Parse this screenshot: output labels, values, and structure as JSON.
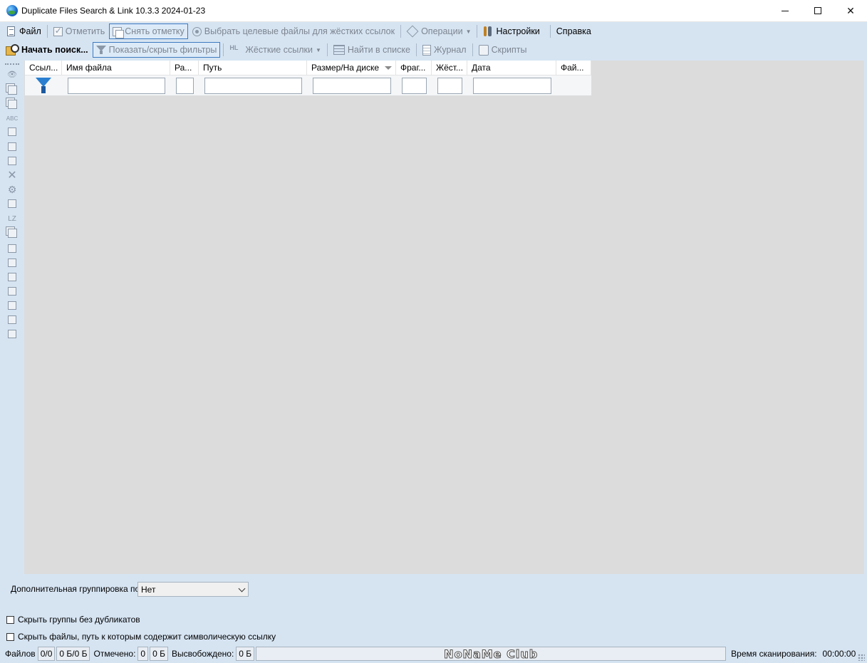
{
  "window": {
    "title": "Duplicate Files Search & Link 10.3.3 2024-01-23"
  },
  "toolbar1": {
    "file": "Файл",
    "mark": "Отметить",
    "unmark": "Снять отметку",
    "select_targets": "Выбрать целевые файлы для жёстких ссылок",
    "operations": "Операции",
    "settings": "Настройки",
    "help": "Справка"
  },
  "toolbar2": {
    "start_search": "Начать поиск...",
    "toggle_filters": "Показать/скрыть фильтры",
    "hard_links": "Жёсткие ссылки",
    "find_in_list": "Найти в списке",
    "journal": "Журнал",
    "scripts": "Скрипты",
    "hl_icon_text": "HL"
  },
  "left_toolbar": {
    "lz_label": "LZ",
    "icons": [
      "eye-icon",
      "copy-add-icon",
      "copy-remove-icon",
      "abc-icon",
      "select-group-icon",
      "select-group-2-icon",
      "select-group-3-icon",
      "delete-icon",
      "gear-icon",
      "move-icon",
      "lz-icon",
      "copy-dropdown-icon",
      "list-1-icon",
      "filter-list-icon",
      "list-2-icon",
      "list-3-icon",
      "list-4-icon",
      "list-5-icon",
      "grid-icon"
    ]
  },
  "grid": {
    "columns": [
      "Ссыл...",
      "Имя файла",
      "Ра...",
      "Путь",
      "Размер/На диске",
      "Фраг...",
      "Жёст...",
      "Дата",
      "Фай..."
    ],
    "sorted_column": "Размер/На диске"
  },
  "options": {
    "grouping_label": "Дополнительная группировка по",
    "grouping_value": "Нет",
    "hide_groups_label": "Скрыть группы без дубликатов",
    "hide_symlinks_label": "Скрыть файлы, путь к которым содержит символическую ссылку",
    "hide_groups_checked": false,
    "hide_symlinks_checked": false
  },
  "status": {
    "files_label": "Файлов",
    "files_count": "0/0",
    "files_size": "0 Б/0 Б",
    "marked_label": "Отмечено:",
    "marked_count": "0",
    "marked_size": "0 Б",
    "freed_label": "Высвобождено:",
    "freed_size": "0 Б",
    "watermark": "NoNaMe Club",
    "scan_time_label": "Время сканирования:",
    "scan_time": "00:00:00"
  }
}
